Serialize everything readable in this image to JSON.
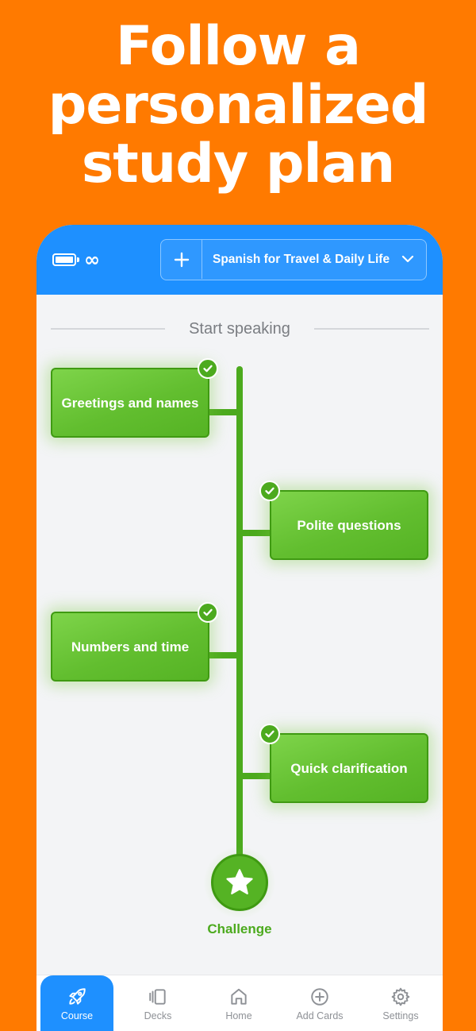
{
  "headline": [
    "Follow a",
    "personalized",
    "study plan"
  ],
  "topbar": {
    "infinity": "∞",
    "course_name": "Spanish for Travel & Daily Life",
    "add_icon": "plus-icon",
    "dropdown_icon": "chevron-down-icon"
  },
  "section": {
    "title": "Start speaking"
  },
  "lessons": [
    {
      "label": "Greetings and names",
      "completed": true
    },
    {
      "label": "Polite questions",
      "completed": true
    },
    {
      "label": "Numbers and time",
      "completed": true
    },
    {
      "label": "Quick clarification",
      "completed": true
    }
  ],
  "challenge": {
    "label": "Challenge",
    "icon": "star-icon"
  },
  "tabs": [
    {
      "label": "Course",
      "icon": "rocket-icon",
      "active": true
    },
    {
      "label": "Decks",
      "icon": "cards-icon",
      "active": false
    },
    {
      "label": "Home",
      "icon": "home-icon",
      "active": false
    },
    {
      "label": "Add Cards",
      "icon": "plus-circle-icon",
      "active": false
    },
    {
      "label": "Settings",
      "icon": "gear-icon",
      "active": false
    }
  ],
  "colors": {
    "background": "#FF7A00",
    "topbar": "#1E90FF",
    "lesson_green": "#62BE2F",
    "path_green": "#4CAA1E",
    "screen_bg": "#F3F4F6"
  }
}
